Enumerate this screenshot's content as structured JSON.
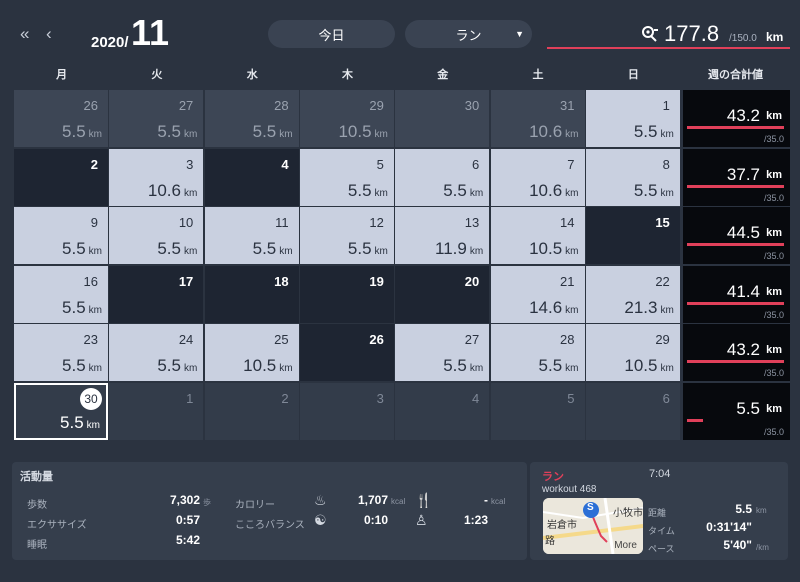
{
  "header": {
    "year": "2020/",
    "month": "11",
    "today_label": "今日",
    "activity_label": "ラン",
    "total_value": "177.8",
    "total_goal": "/150.0",
    "total_unit": "km"
  },
  "weekdays": [
    "月",
    "火",
    "水",
    "木",
    "金",
    "土",
    "日"
  ],
  "week_total_label": "週の合計値",
  "calendar": {
    "unit": "km",
    "rows": [
      [
        {
          "d": "26",
          "v": "5.5",
          "s": "prev"
        },
        {
          "d": "27",
          "v": "5.5",
          "s": "prev"
        },
        {
          "d": "28",
          "v": "5.5",
          "s": "prev"
        },
        {
          "d": "29",
          "v": "10.5",
          "s": "prev"
        },
        {
          "d": "30",
          "v": "",
          "s": "prev"
        },
        {
          "d": "31",
          "v": "10.6",
          "s": "prev"
        },
        {
          "d": "1",
          "v": "5.5",
          "s": "light"
        }
      ],
      [
        {
          "d": "2",
          "v": "",
          "s": "dark"
        },
        {
          "d": "3",
          "v": "10.6",
          "s": "light"
        },
        {
          "d": "4",
          "v": "",
          "s": "dark"
        },
        {
          "d": "5",
          "v": "5.5",
          "s": "light"
        },
        {
          "d": "6",
          "v": "5.5",
          "s": "light"
        },
        {
          "d": "7",
          "v": "10.6",
          "s": "light"
        },
        {
          "d": "8",
          "v": "5.5",
          "s": "light"
        }
      ],
      [
        {
          "d": "9",
          "v": "5.5",
          "s": "light"
        },
        {
          "d": "10",
          "v": "5.5",
          "s": "light"
        },
        {
          "d": "11",
          "v": "5.5",
          "s": "light"
        },
        {
          "d": "12",
          "v": "5.5",
          "s": "light"
        },
        {
          "d": "13",
          "v": "11.9",
          "s": "light"
        },
        {
          "d": "14",
          "v": "10.5",
          "s": "light"
        },
        {
          "d": "15",
          "v": "",
          "s": "dark"
        }
      ],
      [
        {
          "d": "16",
          "v": "5.5",
          "s": "light"
        },
        {
          "d": "17",
          "v": "",
          "s": "dark"
        },
        {
          "d": "18",
          "v": "",
          "s": "dark"
        },
        {
          "d": "19",
          "v": "",
          "s": "dark"
        },
        {
          "d": "20",
          "v": "",
          "s": "dark"
        },
        {
          "d": "21",
          "v": "14.6",
          "s": "light"
        },
        {
          "d": "22",
          "v": "21.3",
          "s": "light"
        }
      ],
      [
        {
          "d": "23",
          "v": "5.5",
          "s": "light"
        },
        {
          "d": "24",
          "v": "5.5",
          "s": "light"
        },
        {
          "d": "25",
          "v": "10.5",
          "s": "light"
        },
        {
          "d": "26",
          "v": "",
          "s": "dark"
        },
        {
          "d": "27",
          "v": "5.5",
          "s": "light"
        },
        {
          "d": "28",
          "v": "5.5",
          "s": "light"
        },
        {
          "d": "29",
          "v": "10.5",
          "s": "light"
        }
      ],
      [
        {
          "d": "30",
          "v": "5.5",
          "s": "today"
        },
        {
          "d": "1",
          "v": "",
          "s": "next"
        },
        {
          "d": "2",
          "v": "",
          "s": "next"
        },
        {
          "d": "3",
          "v": "",
          "s": "next"
        },
        {
          "d": "4",
          "v": "",
          "s": "next"
        },
        {
          "d": "5",
          "v": "",
          "s": "next"
        },
        {
          "d": "6",
          "v": "",
          "s": "next"
        }
      ]
    ]
  },
  "weeks": [
    {
      "value": "43.2",
      "goal": "/35.0",
      "fill": 1.0
    },
    {
      "value": "37.7",
      "goal": "/35.0",
      "fill": 1.0
    },
    {
      "value": "44.5",
      "goal": "/35.0",
      "fill": 1.0
    },
    {
      "value": "41.4",
      "goal": "/35.0",
      "fill": 1.0
    },
    {
      "value": "43.2",
      "goal": "/35.0",
      "fill": 1.0
    },
    {
      "value": "5.5",
      "goal": "/35.0",
      "fill": 0.16
    }
  ],
  "week_unit": "km",
  "activity": {
    "title": "活動量",
    "steps_label": "歩数",
    "steps_value": "7,302",
    "steps_unit": "歩",
    "exercise_label": "エクササイズ",
    "exercise_value": "0:57",
    "sleep_label": "睡眠",
    "sleep_value": "5:42",
    "calorie_label": "カロリー",
    "calorie_value": "1,707",
    "calorie_unit": "kcal",
    "intake_value": "-",
    "intake_unit": "kcal",
    "balance_label": "こころバランス",
    "balance_value": "0:10",
    "meditation_value": "1:23"
  },
  "run": {
    "title": "ラン",
    "time": "7:04",
    "workout": "workout 468",
    "map_label_1": "岩倉市",
    "map_label_2": "小牧市",
    "map_label_3": "路",
    "more": "More",
    "distance_label": "距離",
    "distance_value": "5.5",
    "distance_unit": "km",
    "time_label": "タイム",
    "time_value": "0:31'14\"",
    "pace_label": "ペース",
    "pace_value": "5'40\"",
    "pace_unit": "/km"
  },
  "colors": {
    "accent": "#e0405a",
    "background": "#2b3340",
    "light_cell": "#c9d0e0",
    "dark_cell": "#1e2532"
  }
}
